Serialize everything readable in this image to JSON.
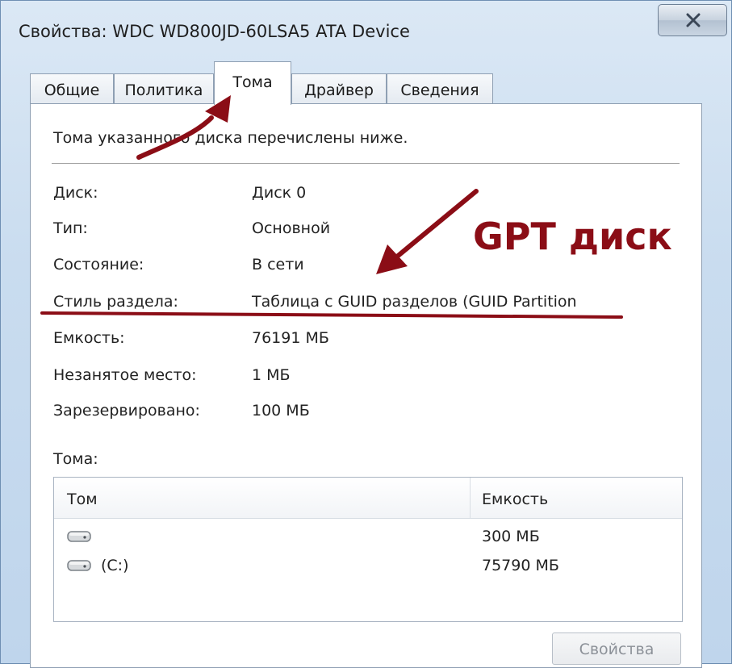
{
  "window": {
    "title": "Свойства: WDC WD800JD-60LSA5 ATA Device",
    "close_icon": "close-icon"
  },
  "tabs": [
    {
      "label": "Общие",
      "active": false
    },
    {
      "label": "Политика",
      "active": false
    },
    {
      "label": "Тома",
      "active": true
    },
    {
      "label": "Драйвер",
      "active": false
    },
    {
      "label": "Сведения",
      "active": false
    }
  ],
  "panel": {
    "description": "Тома указанного диска перечислены ниже.",
    "properties": [
      {
        "label": "Диск:",
        "value": "Диск 0"
      },
      {
        "label": "Тип:",
        "value": "Основной"
      },
      {
        "label": "Состояние:",
        "value": "В сети"
      },
      {
        "label": "Стиль раздела:",
        "value": "Таблица с GUID разделов (GUID Partition"
      },
      {
        "label": "Емкость:",
        "value": "76191 МБ"
      },
      {
        "label": "Незанятое место:",
        "value": "1 МБ"
      },
      {
        "label": "Зарезервировано:",
        "value": "100 МБ"
      }
    ],
    "volumes_label": "Тома:",
    "volumes_table": {
      "columns": [
        "Том",
        "Емкость"
      ],
      "rows": [
        {
          "name": "",
          "capacity": "300 МБ",
          "icon": "hard-drive-icon"
        },
        {
          "name": "(C:)",
          "capacity": "75790 МБ",
          "icon": "hard-drive-icon"
        }
      ]
    },
    "properties_button": "Свойства"
  },
  "annotation": {
    "text": "GPT диск",
    "color": "#8b0d16"
  }
}
